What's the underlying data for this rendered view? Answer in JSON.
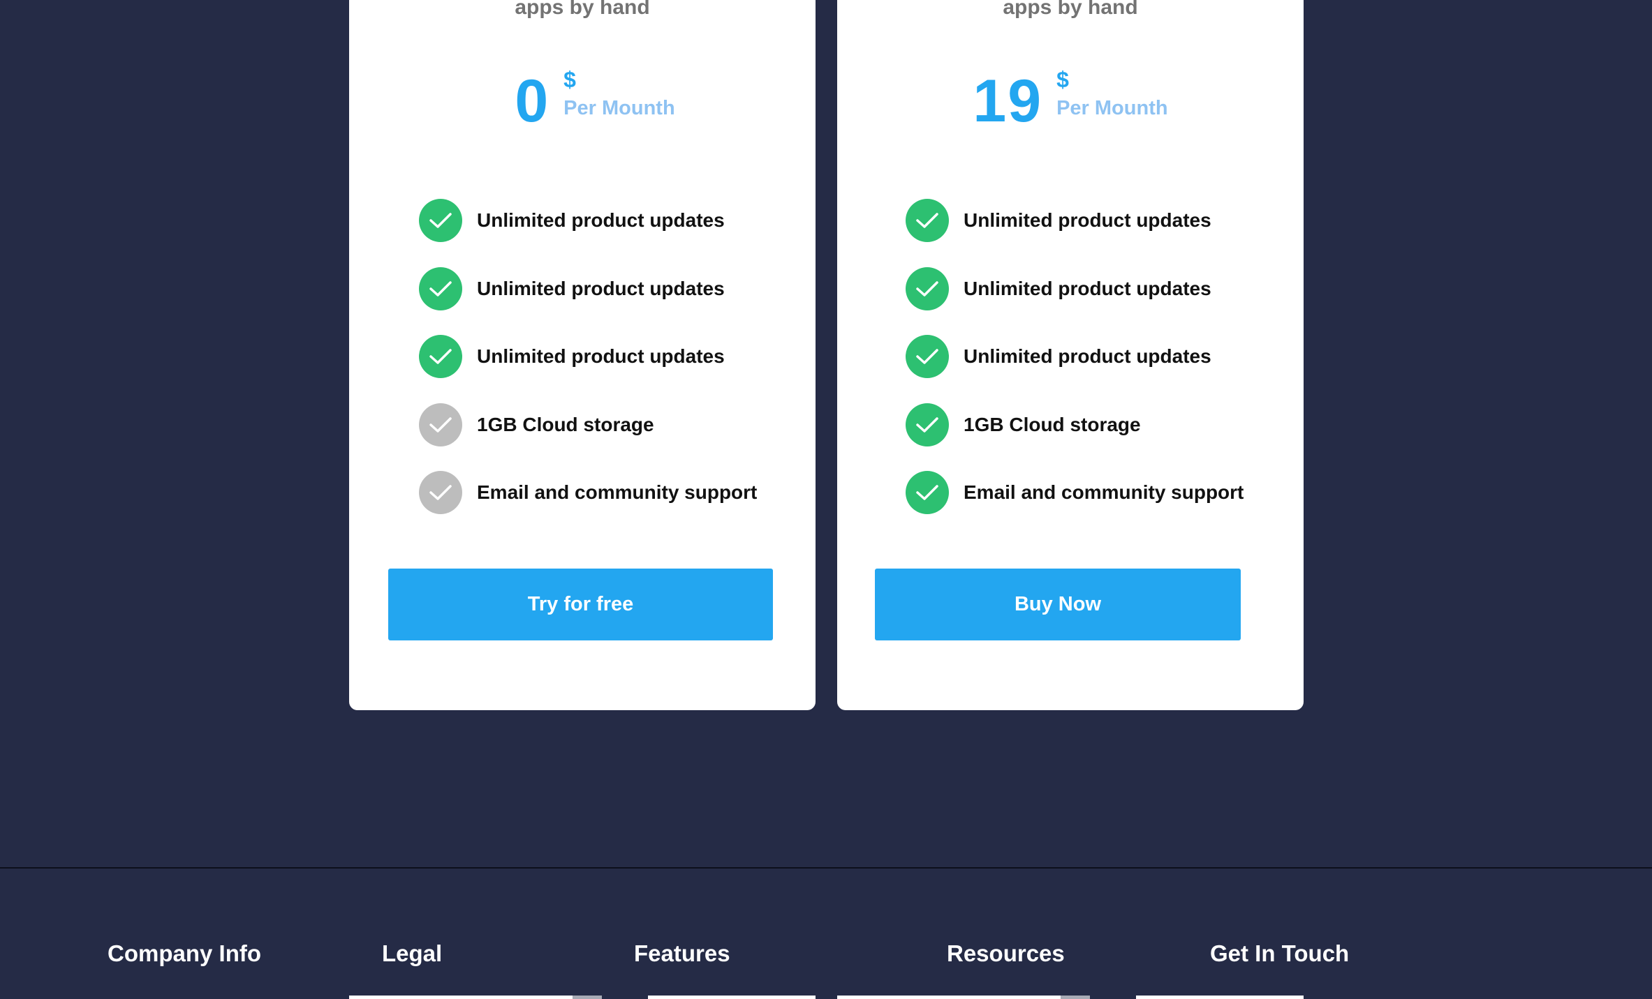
{
  "colors": {
    "background": "#252b46",
    "card": "#ffffff",
    "primary": "#23a6f0",
    "price_muted": "#8ec2f2",
    "check_active": "#2dc071",
    "check_inactive": "#bdbdbd",
    "feature_text": "#111111",
    "subtitle": "#737373"
  },
  "plans": [
    {
      "subtitle": "apps by hand",
      "price": "0",
      "currency": "$",
      "period": "Per Mounth",
      "features": [
        {
          "label": "Unlimited product updates",
          "included": true
        },
        {
          "label": "Unlimited product updates",
          "included": true
        },
        {
          "label": "Unlimited product updates",
          "included": true
        },
        {
          "label": "1GB Cloud storage",
          "included": false
        },
        {
          "label": "Email and community support",
          "included": false
        }
      ],
      "cta": "Try for free"
    },
    {
      "subtitle": "apps by hand",
      "price": "19",
      "currency": "$",
      "period": "Per Mounth",
      "features": [
        {
          "label": "Unlimited product updates",
          "included": true
        },
        {
          "label": "Unlimited product updates",
          "included": true
        },
        {
          "label": "Unlimited product updates",
          "included": true
        },
        {
          "label": "1GB Cloud storage",
          "included": true
        },
        {
          "label": "Email and community support",
          "included": true
        }
      ],
      "cta": "Buy Now"
    }
  ],
  "footer": {
    "columns": [
      "Company Info",
      "Legal",
      "Features",
      "Resources",
      "Get In Touch"
    ]
  }
}
